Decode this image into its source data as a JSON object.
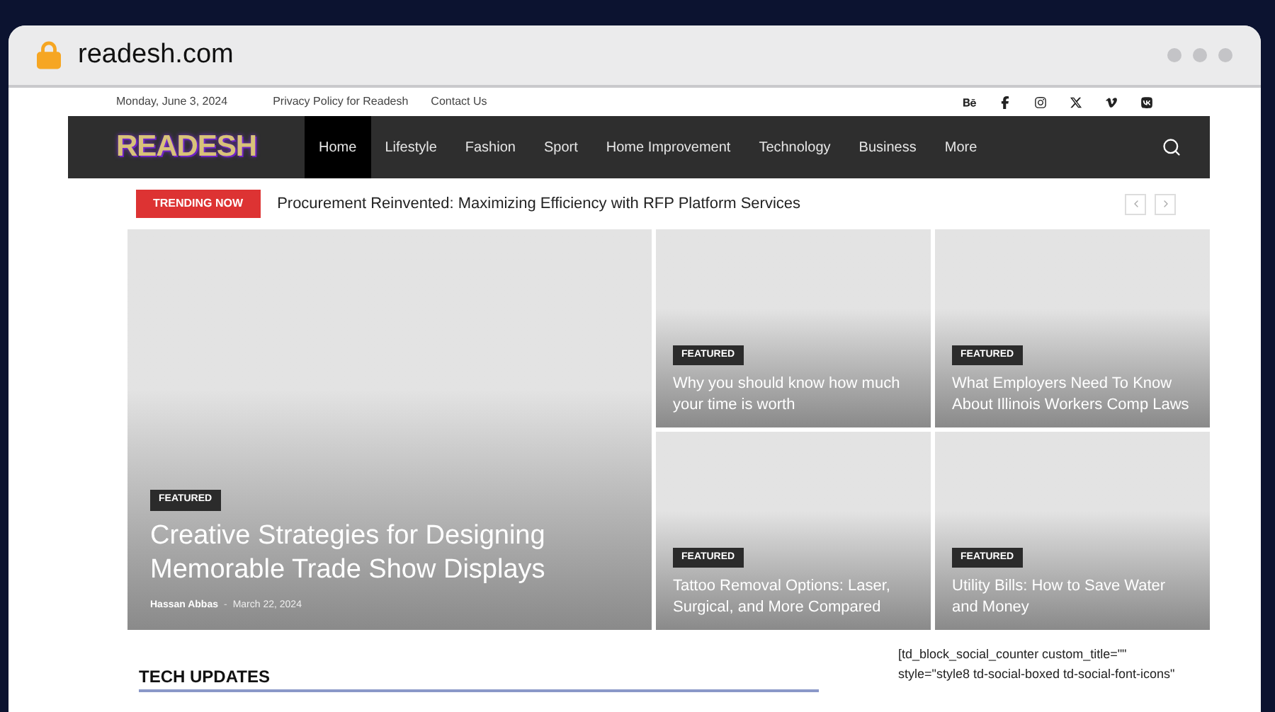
{
  "browser": {
    "url": "readesh.com"
  },
  "top_bar": {
    "date": "Monday, June 3, 2024",
    "links": [
      "Privacy Policy for Readesh",
      "Contact Us"
    ]
  },
  "nav": {
    "logo": "READESH",
    "items": [
      {
        "label": "Home",
        "selected": true
      },
      {
        "label": "Lifestyle",
        "selected": false
      },
      {
        "label": "Fashion",
        "selected": false
      },
      {
        "label": "Sport",
        "selected": false
      },
      {
        "label": "Home Improvement",
        "selected": false
      },
      {
        "label": "Technology",
        "selected": false
      },
      {
        "label": "Business",
        "selected": false
      },
      {
        "label": "More",
        "selected": false
      }
    ]
  },
  "trending": {
    "label": "TRENDING NOW",
    "headline": "Procurement Reinvented: Maximizing Efficiency with RFP Platform Services"
  },
  "featured": [
    {
      "kind": "main",
      "tag": "FEATURED",
      "title": "Creative Strategies for Designing Memorable Trade Show Displays",
      "author": "Hassan Abbas",
      "separator": "-",
      "date": "March 22, 2024"
    },
    {
      "kind": "small",
      "tag": "FEATURED",
      "title": "Why you should know how much your time is worth"
    },
    {
      "kind": "small",
      "tag": "FEATURED",
      "title": "What Employers Need To Know About Illinois Workers Comp Laws"
    },
    {
      "kind": "small",
      "tag": "FEATURED",
      "title": "Tattoo Removal Options: Laser, Surgical, and More Compared"
    },
    {
      "kind": "small",
      "tag": "FEATURED",
      "title": "Utility Bills: How to Save Water and Money"
    }
  ],
  "section": {
    "heading": "TECH UPDATES"
  },
  "sidebar": {
    "lines": [
      "[td_block_social_counter custom_title=\"\"",
      "style=\"style8 td-social-boxed td-social-font-icons\""
    ]
  }
}
